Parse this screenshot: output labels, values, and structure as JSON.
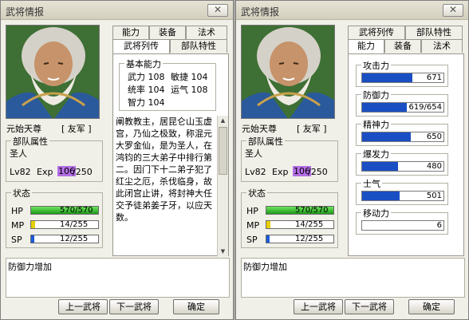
{
  "window": {
    "title": "武将情报",
    "close_glyph": "✕"
  },
  "general": {
    "name": "元始天尊",
    "faction": "[ 友军 ]",
    "unit_attr_title": "部队属性",
    "unit_attr": "圣人",
    "level": "Lv82",
    "exp_label": "Exp",
    "exp_current": "106",
    "exp_max": "/250"
  },
  "status": {
    "title": "状态",
    "hp_label": "HP",
    "hp_value": "570/570",
    "mp_label": "MP",
    "mp_value": "14/255",
    "sp_label": "SP",
    "sp_value": "12/255",
    "hp_frac": 1.0,
    "mp_frac": 0.055,
    "sp_frac": 0.047
  },
  "left_tabs": [
    "能力",
    "装备",
    "法术",
    "武将列传",
    "部队特性"
  ],
  "basic": {
    "title": "基本能力",
    "rows": [
      "武力 108",
      "敏捷 104",
      "统率 104",
      "运气 108",
      "智力 104"
    ]
  },
  "bio": "阐教教主，居昆仑山玉虚宫，乃仙之极致，称混元大罗金仙，是为圣人，在鸿钧的三大弟子中排行第二。因门下十二弟子犯了红尘之厄，杀伐临身，故此闭宫止讲，将封神大任交予徒弟姜子牙，以应天数。",
  "effect": {
    "text": "防御力增加"
  },
  "buttons": {
    "prev": "上一武将",
    "next": "下一武将",
    "ok": "确定"
  },
  "right_tabs": [
    "武将列传",
    "部队特性",
    "能力",
    "装备",
    "法术"
  ],
  "attributes": [
    {
      "label": "攻击力",
      "value": "671",
      "frac": 0.62
    },
    {
      "label": "防御力",
      "value": "619/654",
      "frac": 0.55
    },
    {
      "label": "精神力",
      "value": "650",
      "frac": 0.6
    },
    {
      "label": "爆发力",
      "value": "480",
      "frac": 0.44
    },
    {
      "label": "士气",
      "value": "501",
      "frac": 0.46
    },
    {
      "label": "移动力",
      "value": "6",
      "frac": 0
    }
  ],
  "colors": {
    "hp": "#22c11f",
    "mp": "#e6d000",
    "sp": "#1d5ad8",
    "attr": "#1a4fc4",
    "exp": "#b46fe6"
  }
}
